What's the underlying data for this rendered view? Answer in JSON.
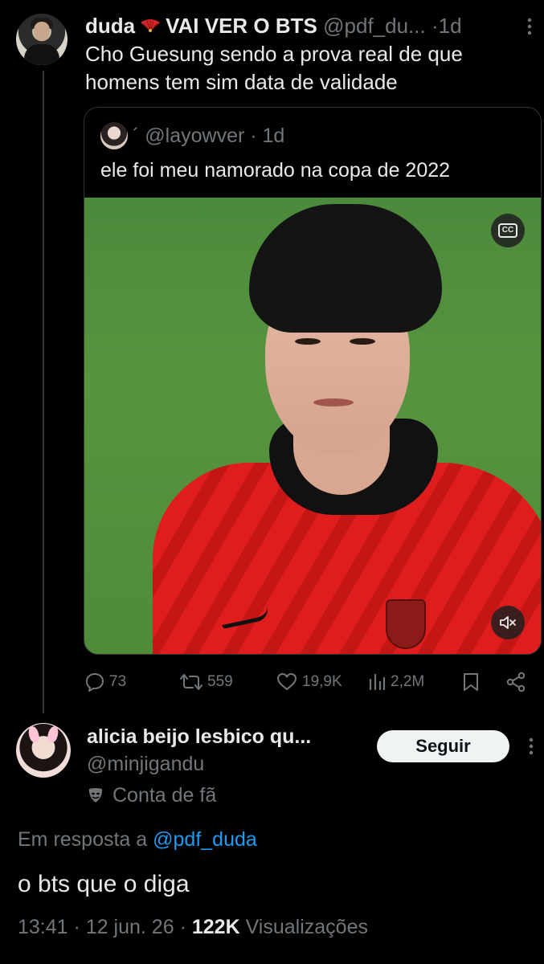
{
  "tweet": {
    "author_name": "duda",
    "author_name_suffix": "VAI VER O BTS",
    "handle": "@pdf_du...",
    "separator": "·",
    "time": "1d",
    "text": "Cho Guesung sendo a prova real de que homens tem sim data de validade",
    "quote": {
      "handle": "´ @layowver",
      "separator": "·",
      "time": "1d",
      "text": "ele foi meu namorado na copa de 2022",
      "cc_label": "CC"
    },
    "stats": {
      "replies": "73",
      "retweets": "559",
      "likes": "19,9K",
      "views": "2,2M"
    }
  },
  "reply": {
    "author_name": "alicia beijo lesbico qu...",
    "handle": "@minjigandu",
    "badge": "Conta de fã",
    "follow_label": "Seguir",
    "in_reply_prefix": "Em resposta a",
    "in_reply_mention": "@pdf_duda",
    "text": "o bts que o diga",
    "time": "13:41",
    "date": "12 jun. 26",
    "views_count": "122K",
    "views_label": "Visualizações",
    "sep": "·"
  },
  "colors": {
    "background": "#000000",
    "text": "#e7e9ea",
    "muted": "#71767b",
    "link": "#1d9bf0",
    "border": "#2f3336"
  },
  "icons": {
    "reply": "comment-bubble-icon",
    "retweet": "retweet-icon",
    "like": "heart-icon",
    "views": "bar-chart-icon",
    "bookmark": "bookmark-icon",
    "share": "share-icon",
    "more": "more-vertical-icon",
    "fan": "red-fan-emoji-icon",
    "badge": "theater-masks-icon",
    "mute": "volume-muted-icon",
    "cc": "closed-captions-icon"
  }
}
